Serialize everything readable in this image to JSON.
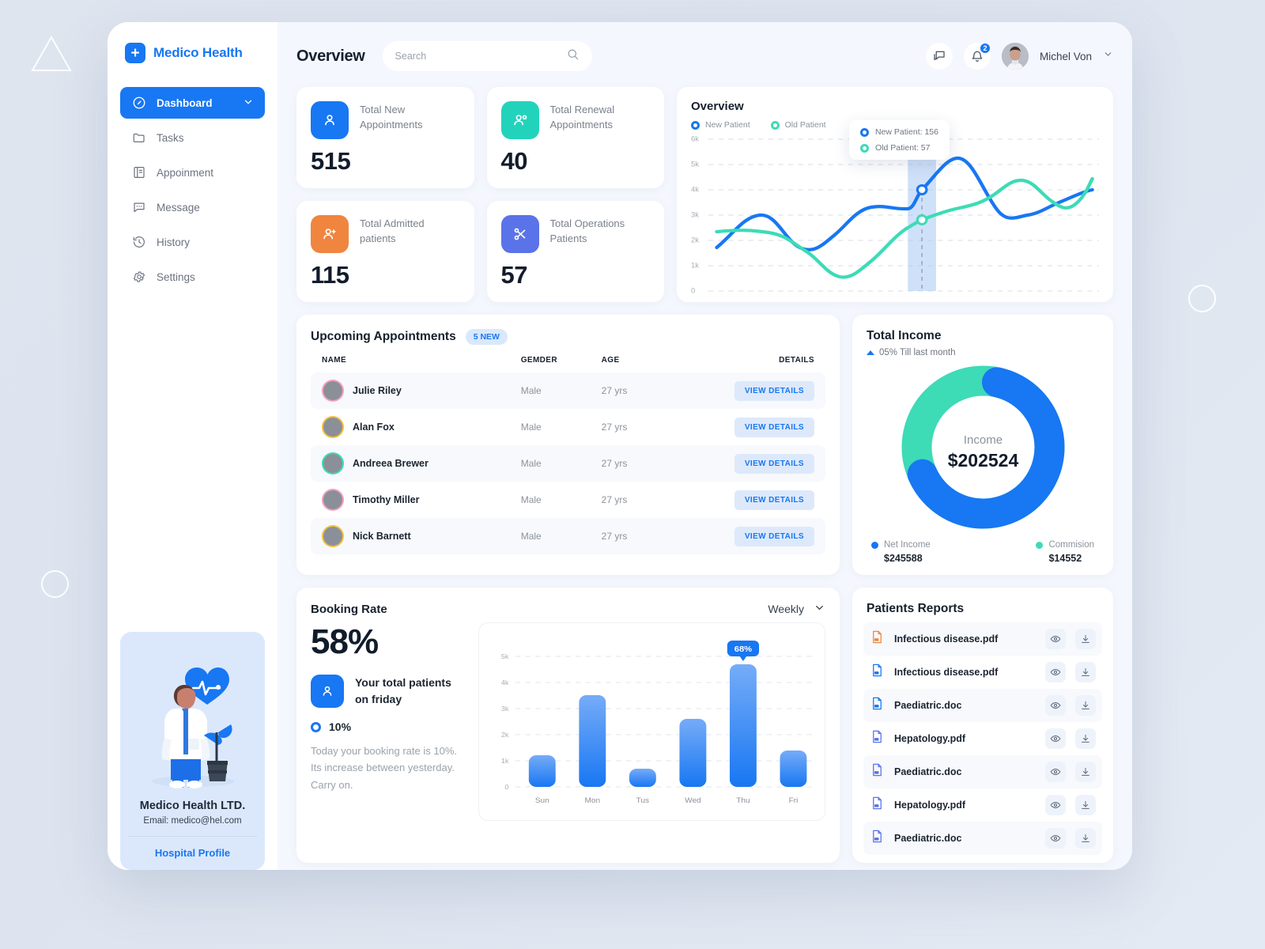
{
  "brand": {
    "name": "Medico Health",
    "logo_icon": "plus-icon"
  },
  "sidebar": {
    "items": [
      {
        "label": "Dashboard",
        "icon": "gauge-icon",
        "active": true
      },
      {
        "label": "Tasks",
        "icon": "folder-icon",
        "active": false
      },
      {
        "label": "Appoinment",
        "icon": "book-icon",
        "active": false
      },
      {
        "label": "Message",
        "icon": "chat-icon",
        "active": false
      },
      {
        "label": "History",
        "icon": "history-icon",
        "active": false
      },
      {
        "label": "Settings",
        "icon": "gear-icon",
        "active": false
      }
    ],
    "profile": {
      "title": "Medico Health LTD.",
      "email": "Email: medico@hel.com",
      "link": "Hospital Profile"
    }
  },
  "header": {
    "title": "Overview",
    "search_placeholder": "Search",
    "search_value": "",
    "message_icon": "chat-icon",
    "bell_icon": "bell-icon",
    "notification_count": "2",
    "user_name": "Michel Von",
    "chevron_icon": "chevron-down-icon"
  },
  "stats": [
    {
      "label": "Total New Appointments",
      "value": "515",
      "icon": "user-icon",
      "color": "#1877f2"
    },
    {
      "label": "Total Renewal Appointments",
      "value": "40",
      "icon": "user-sync-icon",
      "color": "#22d3bb"
    },
    {
      "label": "Total Admitted patients",
      "value": "115",
      "icon": "user-add-icon",
      "color": "#f0853f"
    },
    {
      "label": "Total Operations Patients",
      "value": "57",
      "icon": "scissors-icon",
      "color": "#5b73e8"
    }
  ],
  "appointments": {
    "title": "Upcoming Appointments",
    "badge": "5 NEW",
    "columns": [
      "NAME",
      "GEMDER",
      "AGE",
      "DETAILS"
    ],
    "rows": [
      {
        "name": "Julie Riley",
        "gender": "Male",
        "age": "27 yrs",
        "action": "VIEW DETAILS",
        "ring": "#f2a0bd"
      },
      {
        "name": "Alan Fox",
        "gender": "Male",
        "age": "27 yrs",
        "action": "VIEW DETAILS",
        "ring": "#f0c040"
      },
      {
        "name": "Andreea Brewer",
        "gender": "Male",
        "age": "27 yrs",
        "action": "VIEW DETAILS",
        "ring": "#3ddbb6"
      },
      {
        "name": "Timothy Miller",
        "gender": "Male",
        "age": "27 yrs",
        "action": "VIEW DETAILS",
        "ring": "#f2a0bd"
      },
      {
        "name": "Nick Barnett",
        "gender": "Male",
        "age": "27 yrs",
        "action": "VIEW DETAILS",
        "ring": "#f0c040"
      }
    ]
  },
  "income": {
    "title": "Total Income",
    "trend": "05% Till last month",
    "center_label": "Income",
    "center_value": "$202524",
    "legend": [
      {
        "label": "Net Income",
        "value": "$245588",
        "color": "#1877f2"
      },
      {
        "label": "Commision",
        "value": "$14552",
        "color": "#3ddbb6"
      }
    ]
  },
  "booking": {
    "title": "Booking Rate",
    "period": "Weekly",
    "percent": "58%",
    "total_patients_text": "Your total patients on friday",
    "rate_label": "10%",
    "note": "Today your booking rate is 10%. Its increase between yesterday. Carry on.",
    "icon": "user-icon"
  },
  "reports": {
    "title": "Patients Reports",
    "view_icon": "eye-icon",
    "download_icon": "download-icon",
    "items": [
      {
        "name": "Infectious disease.pdf",
        "color": "#f0853f"
      },
      {
        "name": "Infectious disease.pdf",
        "color": "#1877f2"
      },
      {
        "name": "Paediatric.doc",
        "color": "#1877f2"
      },
      {
        "name": "Hepatology.pdf",
        "color": "#5b73e8"
      },
      {
        "name": "Paediatric.doc",
        "color": "#5b73e8"
      },
      {
        "name": "Hepatology.pdf",
        "color": "#5b73e8"
      },
      {
        "name": "Paediatric.doc",
        "color": "#5b73e8"
      }
    ]
  },
  "chart_data": [
    {
      "type": "line",
      "title": "Overview",
      "legend": [
        "New Patient",
        "Old Patient"
      ],
      "legend_position": "top-left",
      "colors": [
        "#1877f2",
        "#3ddbb6"
      ],
      "ylim": [
        0,
        6000
      ],
      "yticks": [
        "0",
        "1k",
        "2k",
        "3k",
        "4k",
        "5k",
        "6k"
      ],
      "grid": true,
      "series": [
        {
          "name": "New Patient",
          "values": [
            1700,
            2400,
            2900,
            2200,
            1700,
            1950,
            3100,
            3150,
            3200,
            4000,
            5050,
            4350,
            3200,
            3150,
            3550,
            3900,
            4050
          ]
        },
        {
          "name": "Old Patient",
          "values": [
            2350,
            2350,
            2300,
            2150,
            1950,
            1300,
            700,
            900,
            1500,
            2100,
            2500,
            2700,
            2950,
            3950,
            3350,
            3100,
            4600
          ]
        }
      ],
      "tooltip": {
        "x_index": 9,
        "rows": [
          "New Patient: 156",
          "Old Patient: 57"
        ]
      }
    },
    {
      "type": "pie",
      "title": "Total Income",
      "subtitle": "05% Till last month",
      "center_label": "Income",
      "center_value": "$202524",
      "labels": [
        "Net Income",
        "Commision"
      ],
      "values": [
        245588,
        14552
      ],
      "fractions": [
        0.65,
        0.35
      ],
      "colors": [
        "#1877f2",
        "#3ddbb6"
      ]
    },
    {
      "type": "bar",
      "title": "Booking Rate",
      "categories": [
        "Sun",
        "Mon",
        "Tus",
        "Wed",
        "Thu",
        "Fri"
      ],
      "values": [
        1200,
        3500,
        700,
        2600,
        4700,
        1400
      ],
      "ylim": [
        0,
        5000
      ],
      "yticks": [
        "0",
        "1k",
        "2k",
        "3k",
        "4k",
        "5k"
      ],
      "grid": true,
      "highlight": {
        "category": "Thu",
        "label": "68%"
      },
      "colors": [
        "#2b86f5"
      ]
    }
  ]
}
